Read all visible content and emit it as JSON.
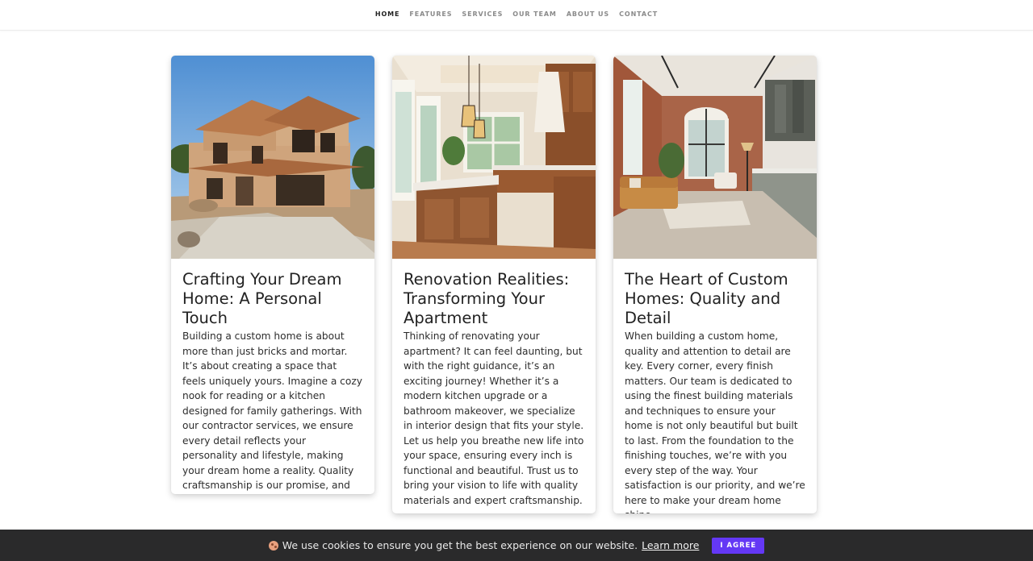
{
  "nav": {
    "items": [
      {
        "label": "HOME",
        "active": true
      },
      {
        "label": "FEATURES",
        "active": false
      },
      {
        "label": "SERVICES",
        "active": false
      },
      {
        "label": "OUR TEAM",
        "active": false
      },
      {
        "label": "ABOUT US",
        "active": false
      },
      {
        "label": "CONTACT",
        "active": false
      }
    ]
  },
  "cards": [
    {
      "title": "Crafting Your Dream Home: A Personal Touch",
      "text": "Building a custom home is about more than just bricks and mortar. It’s about creating a space that feels uniquely yours. Imagine a cozy nook for reading or a kitchen designed for family gatherings. With our contractor services, we ensure every detail reflects your personality and lifestyle, making your dream home a reality. Quality craftsmanship is our promise, and your vision is our blueprint."
    },
    {
      "title": "Renovation Realities: Transforming Your Apartment",
      "text": "Thinking of renovating your apartment? It can feel daunting, but with the right guidance, it’s an exciting journey! Whether it’s a modern kitchen upgrade or a bathroom makeover, we specialize in interior design that fits your style. Let us help you breathe new life into your space, ensuring every inch is functional and beautiful. Trust us to bring your vision to life with quality materials and expert craftsmanship."
    },
    {
      "title": "The Heart of Custom Homes: Quality and Detail",
      "text": "When building a custom home, quality and attention to detail are key. Every corner, every finish matters. Our team is dedicated to using the finest building materials and techniques to ensure your home is not only beautiful but built to last. From the foundation to the finishing touches, we’re with you every step of the way. Your satisfaction is our priority, and we’re here to make your dream home shine."
    }
  ],
  "cookie": {
    "message": "We use cookies to ensure you get the best experience on our website.",
    "link": "Learn more",
    "button": "I AGREE",
    "icon": "cookie-icon"
  },
  "colors": {
    "accent": "#6438f5",
    "cookie_bar": "#2a2a2b"
  }
}
